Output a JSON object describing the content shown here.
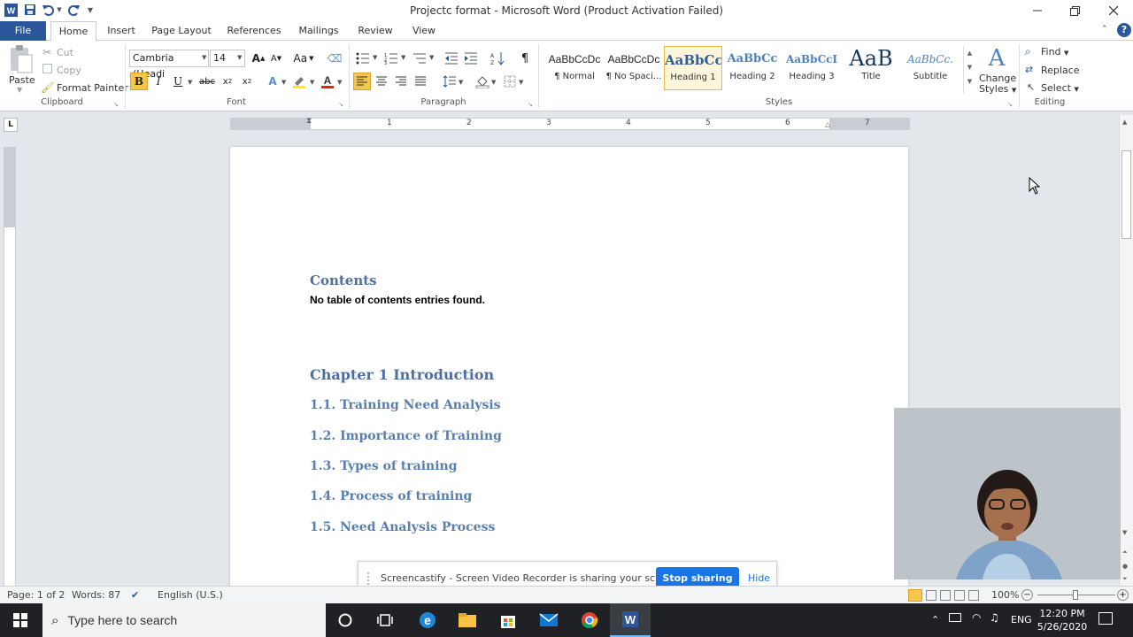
{
  "window": {
    "title": "Projectc format  -  Microsoft Word (Product Activation Failed)"
  },
  "tabs": [
    "File",
    "Home",
    "Insert",
    "Page Layout",
    "References",
    "Mailings",
    "Review",
    "View"
  ],
  "clipboard": {
    "paste": "Paste",
    "cut": "Cut",
    "copy": "Copy",
    "format_painter": "Format Painter",
    "label": "Clipboard"
  },
  "font": {
    "name": "Cambria (Headi",
    "size": "14",
    "label": "Font",
    "change_case": "Aa"
  },
  "paragraph": {
    "label": "Paragraph"
  },
  "styles": {
    "label": "Styles",
    "items": [
      {
        "preview": "AaBbCcDc",
        "name": "¶ Normal"
      },
      {
        "preview": "AaBbCcDc",
        "name": "¶ No Spaci..."
      },
      {
        "preview": "AaBbCc",
        "name": "Heading 1"
      },
      {
        "preview": "AaBbCc",
        "name": "Heading 2"
      },
      {
        "preview": "AaBbCcI",
        "name": "Heading 3"
      },
      {
        "preview": "AaB",
        "name": "Title"
      },
      {
        "preview": "AaBbCc.",
        "name": "Subtitle"
      }
    ],
    "change_styles": [
      "Change",
      "Styles"
    ]
  },
  "editing": {
    "find": "Find",
    "replace": "Replace",
    "select": "Select",
    "label": "Editing"
  },
  "ruler": {
    "numbers": [
      "1",
      "2",
      "3",
      "4",
      "5",
      "6",
      "7"
    ]
  },
  "document": {
    "contents_heading": "Contents",
    "toc_message": "No table of contents entries found.",
    "chapter": "Chapter 1 Introduction",
    "sections": [
      "1.1. Training Need Analysis",
      "1.2. Importance of Training",
      "1.3. Types of training",
      "1.4. Process of training",
      "1.5. Need Analysis Process"
    ]
  },
  "share_banner": {
    "message": "Screencastify - Screen Video Recorder is sharing your screen.",
    "stop": "Stop sharing",
    "hide": "Hide"
  },
  "status": {
    "page": "Page: 1 of 2",
    "words": "Words: 87",
    "language": "English (U.S.)",
    "zoom": "100%"
  },
  "taskbar": {
    "search_placeholder": "Type here to search",
    "lang": "ENG",
    "time": "12:20 PM",
    "date": "5/26/2020"
  },
  "colors": {
    "heading": "#4f6fa0",
    "file_tab": "#2b579a",
    "stop_button": "#1a73e8"
  }
}
